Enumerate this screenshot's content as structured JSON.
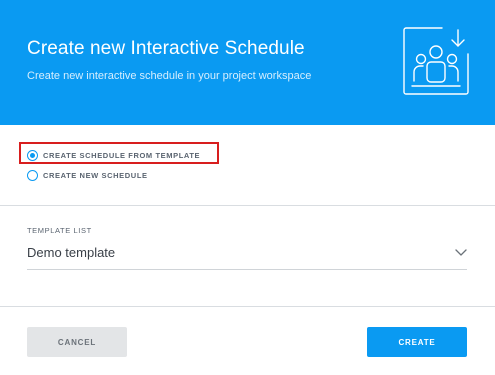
{
  "dialog": {
    "title": "Create new Interactive Schedule",
    "subtitle": "Create new interactive schedule in your project workspace",
    "illustration_icon": "team-download-icon"
  },
  "options": {
    "items": [
      {
        "label": "CREATE SCHEDULE FROM TEMPLATE",
        "selected": true
      },
      {
        "label": "CREATE NEW SCHEDULE",
        "selected": false
      }
    ]
  },
  "template": {
    "label": "TEMPLATE LIST",
    "value": "Demo template",
    "icon": "chevron-down-icon"
  },
  "buttons": {
    "cancel": "CANCEL",
    "create": "CREATE"
  },
  "colors": {
    "accent": "#0a9af2",
    "highlight": "#d81e1e",
    "cancel_bg": "#e3e5e7"
  }
}
